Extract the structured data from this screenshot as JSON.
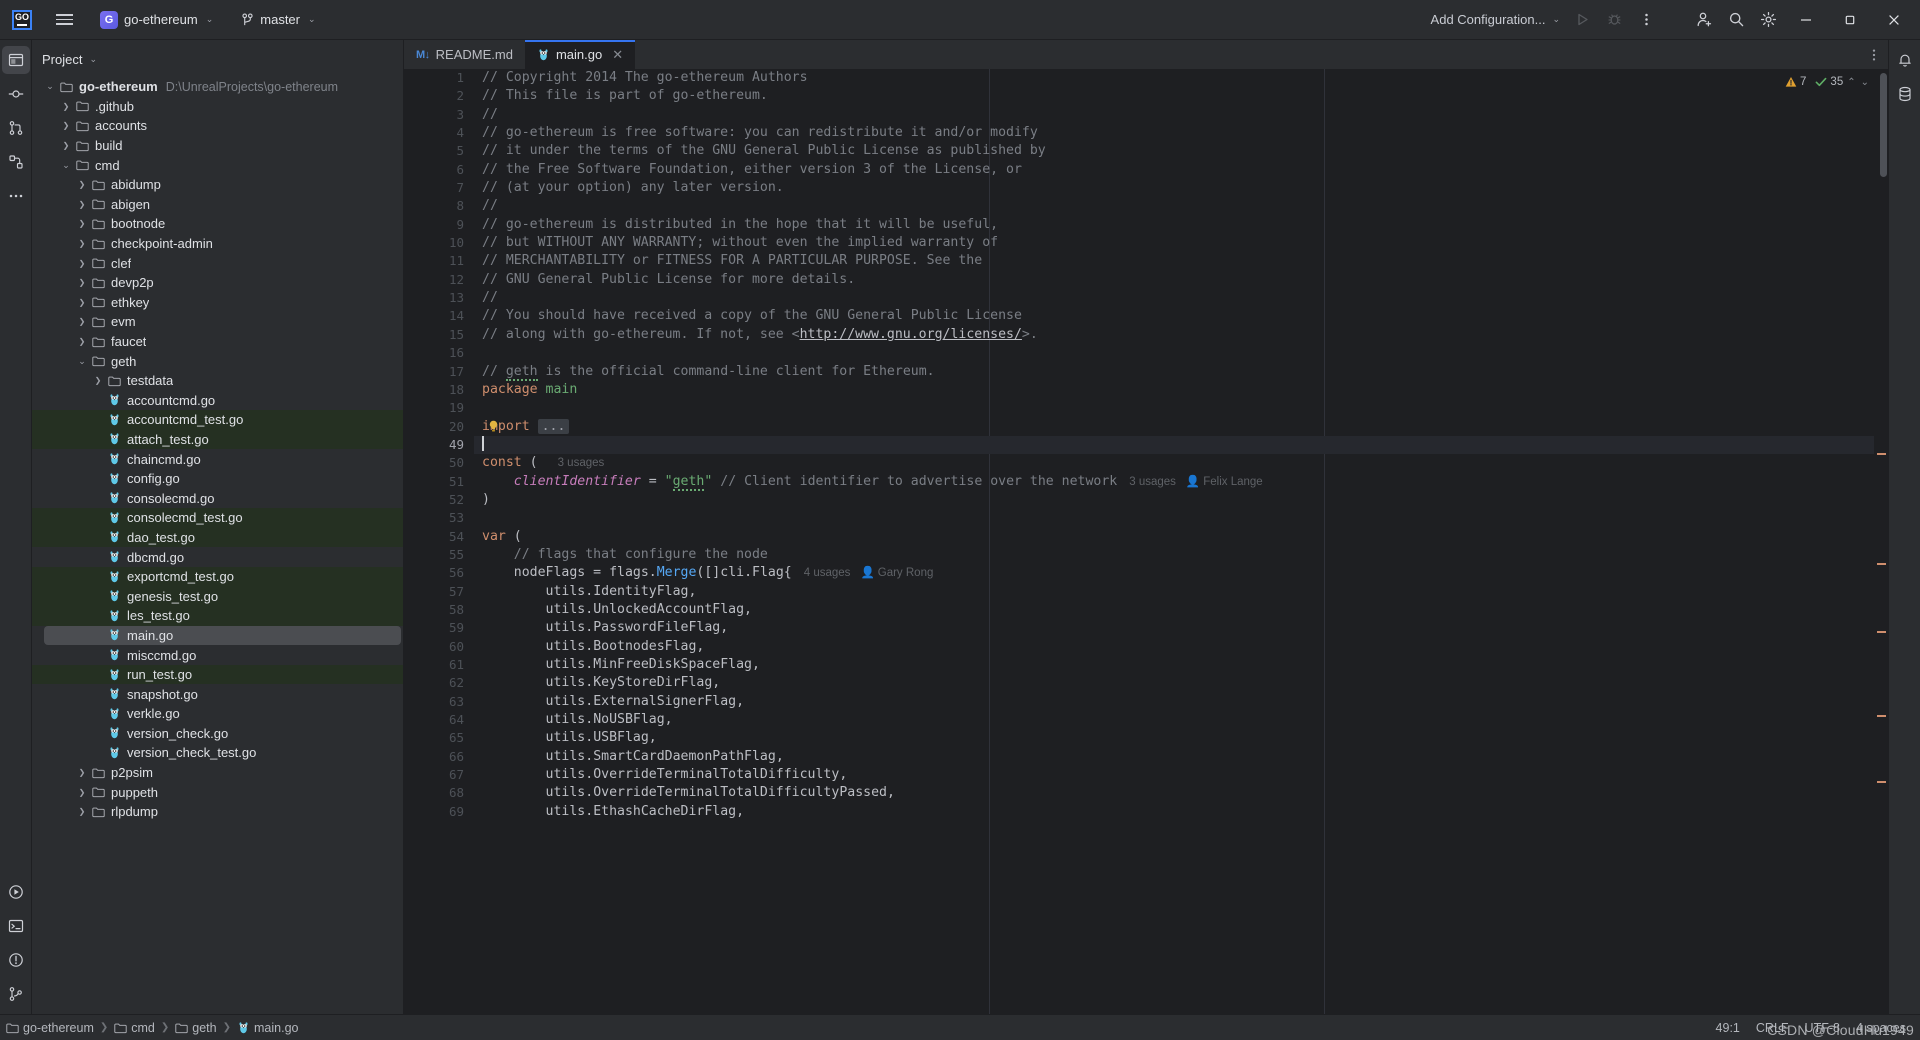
{
  "titlebar": {
    "logo_text": "GO",
    "project_badge": "G",
    "project_name": "go-ethereum",
    "branch": "master",
    "run_config": "Add Configuration...",
    "icons": {
      "hamburger": "hamburger-icon",
      "branch": "branch-icon",
      "run": "run-icon",
      "debug": "debug-icon",
      "more": "more-vertical-icon",
      "account": "add-account-icon",
      "search": "search-icon",
      "settings": "gear-icon",
      "minimize": "minimize-icon",
      "maximize": "maximize-icon",
      "close": "close-icon"
    }
  },
  "left_rail": [
    {
      "name": "project-tool-icon",
      "label": "Project",
      "active": true
    },
    {
      "name": "commit-tool-icon",
      "label": "Commit",
      "active": false
    },
    {
      "name": "pull-requests-tool-icon",
      "label": "Pull Requests",
      "active": false
    },
    {
      "name": "structure-tool-icon",
      "label": "Structure",
      "active": false
    },
    {
      "name": "more-tool-windows-icon",
      "label": "More Tool Windows",
      "active": false
    },
    {
      "name": "run-tool-icon",
      "label": "Run",
      "active": false
    },
    {
      "name": "terminal-tool-icon",
      "label": "Terminal",
      "active": false
    },
    {
      "name": "problems-tool-icon",
      "label": "Problems",
      "active": false
    },
    {
      "name": "git-tool-icon",
      "label": "Git",
      "active": false
    }
  ],
  "right_rail": [
    {
      "name": "notifications-icon",
      "label": "Notifications"
    },
    {
      "name": "database-icon",
      "label": "Database"
    }
  ],
  "project_panel": {
    "title": "Project",
    "tree": [
      {
        "indent": 0,
        "arrow": "down",
        "icon": "folder",
        "label": "go-ethereum",
        "bold": true,
        "path": "D:\\UnrealProjects\\go-ethereum"
      },
      {
        "indent": 1,
        "arrow": "right",
        "icon": "folder",
        "label": ".github"
      },
      {
        "indent": 1,
        "arrow": "right",
        "icon": "folder",
        "label": "accounts"
      },
      {
        "indent": 1,
        "arrow": "right",
        "icon": "folder",
        "label": "build"
      },
      {
        "indent": 1,
        "arrow": "down",
        "icon": "folder",
        "label": "cmd"
      },
      {
        "indent": 2,
        "arrow": "right",
        "icon": "folder",
        "label": "abidump"
      },
      {
        "indent": 2,
        "arrow": "right",
        "icon": "folder",
        "label": "abigen"
      },
      {
        "indent": 2,
        "arrow": "right",
        "icon": "folder",
        "label": "bootnode"
      },
      {
        "indent": 2,
        "arrow": "right",
        "icon": "folder",
        "label": "checkpoint-admin"
      },
      {
        "indent": 2,
        "arrow": "right",
        "icon": "folder",
        "label": "clef"
      },
      {
        "indent": 2,
        "arrow": "right",
        "icon": "folder",
        "label": "devp2p"
      },
      {
        "indent": 2,
        "arrow": "right",
        "icon": "folder",
        "label": "ethkey"
      },
      {
        "indent": 2,
        "arrow": "right",
        "icon": "folder",
        "label": "evm"
      },
      {
        "indent": 2,
        "arrow": "right",
        "icon": "folder",
        "label": "faucet"
      },
      {
        "indent": 2,
        "arrow": "down",
        "icon": "folder",
        "label": "geth"
      },
      {
        "indent": 3,
        "arrow": "right",
        "icon": "folder",
        "label": "testdata"
      },
      {
        "indent": 3,
        "arrow": "none",
        "icon": "go",
        "label": "accountcmd.go"
      },
      {
        "indent": 3,
        "arrow": "none",
        "icon": "go",
        "label": "accountcmd_test.go",
        "test": true
      },
      {
        "indent": 3,
        "arrow": "none",
        "icon": "go",
        "label": "attach_test.go",
        "test": true
      },
      {
        "indent": 3,
        "arrow": "none",
        "icon": "go",
        "label": "chaincmd.go"
      },
      {
        "indent": 3,
        "arrow": "none",
        "icon": "go",
        "label": "config.go"
      },
      {
        "indent": 3,
        "arrow": "none",
        "icon": "go",
        "label": "consolecmd.go"
      },
      {
        "indent": 3,
        "arrow": "none",
        "icon": "go",
        "label": "consolecmd_test.go",
        "test": true
      },
      {
        "indent": 3,
        "arrow": "none",
        "icon": "go",
        "label": "dao_test.go",
        "test": true
      },
      {
        "indent": 3,
        "arrow": "none",
        "icon": "go",
        "label": "dbcmd.go"
      },
      {
        "indent": 3,
        "arrow": "none",
        "icon": "go",
        "label": "exportcmd_test.go",
        "test": true
      },
      {
        "indent": 3,
        "arrow": "none",
        "icon": "go",
        "label": "genesis_test.go",
        "test": true
      },
      {
        "indent": 3,
        "arrow": "none",
        "icon": "go",
        "label": "les_test.go",
        "test": true
      },
      {
        "indent": 3,
        "arrow": "none",
        "icon": "go",
        "label": "main.go",
        "selected": true
      },
      {
        "indent": 3,
        "arrow": "none",
        "icon": "go",
        "label": "misccmd.go"
      },
      {
        "indent": 3,
        "arrow": "none",
        "icon": "go",
        "label": "run_test.go",
        "test": true
      },
      {
        "indent": 3,
        "arrow": "none",
        "icon": "go",
        "label": "snapshot.go"
      },
      {
        "indent": 3,
        "arrow": "none",
        "icon": "go",
        "label": "verkle.go"
      },
      {
        "indent": 3,
        "arrow": "none",
        "icon": "go",
        "label": "version_check.go"
      },
      {
        "indent": 3,
        "arrow": "none",
        "icon": "go",
        "label": "version_check_test.go"
      },
      {
        "indent": 2,
        "arrow": "right",
        "icon": "folder",
        "label": "p2psim"
      },
      {
        "indent": 2,
        "arrow": "right",
        "icon": "folder",
        "label": "puppeth"
      },
      {
        "indent": 2,
        "arrow": "right",
        "icon": "folder",
        "label": "rlpdump"
      }
    ]
  },
  "tabs": [
    {
      "label": "README.md",
      "icon": "markdown-icon",
      "active": false,
      "closable": false
    },
    {
      "label": "main.go",
      "icon": "go-icon",
      "active": true,
      "closable": true
    }
  ],
  "inspections": {
    "warnings": "7",
    "ok": "35"
  },
  "editor": {
    "lines": [
      {
        "n": "1",
        "tokens": [
          {
            "t": "// Copyright 2014 The go-ethereum Authors",
            "c": "c-com"
          }
        ]
      },
      {
        "n": "2",
        "tokens": [
          {
            "t": "// This file is part of go-ethereum.",
            "c": "c-com"
          }
        ]
      },
      {
        "n": "3",
        "tokens": [
          {
            "t": "//",
            "c": "c-com"
          }
        ]
      },
      {
        "n": "4",
        "tokens": [
          {
            "t": "// go-ethereum is free software: you can redistribute it and/or modify",
            "c": "c-com"
          }
        ]
      },
      {
        "n": "5",
        "tokens": [
          {
            "t": "// it under the terms of the GNU General Public License as published by",
            "c": "c-com"
          }
        ]
      },
      {
        "n": "6",
        "tokens": [
          {
            "t": "// the Free Software Foundation, either version 3 of the License, or",
            "c": "c-com"
          }
        ]
      },
      {
        "n": "7",
        "tokens": [
          {
            "t": "// (at your option) any later version.",
            "c": "c-com"
          }
        ]
      },
      {
        "n": "8",
        "tokens": [
          {
            "t": "//",
            "c": "c-com"
          }
        ]
      },
      {
        "n": "9",
        "tokens": [
          {
            "t": "// go-ethereum is distributed in the hope that it will be useful,",
            "c": "c-com"
          }
        ]
      },
      {
        "n": "10",
        "tokens": [
          {
            "t": "// but WITHOUT ANY WARRANTY; without even the implied warranty of",
            "c": "c-com"
          }
        ]
      },
      {
        "n": "11",
        "tokens": [
          {
            "t": "// MERCHANTABILITY or FITNESS FOR A PARTICULAR PURPOSE. See the",
            "c": "c-com"
          }
        ]
      },
      {
        "n": "12",
        "tokens": [
          {
            "t": "// GNU General Public License for more details.",
            "c": "c-com"
          }
        ]
      },
      {
        "n": "13",
        "tokens": [
          {
            "t": "//",
            "c": "c-com"
          }
        ]
      },
      {
        "n": "14",
        "tokens": [
          {
            "t": "// You should have received a copy of the GNU General Public License",
            "c": "c-com"
          }
        ]
      },
      {
        "n": "15",
        "tokens": [
          {
            "t": "// along with go-ethereum. If not, see <",
            "c": "c-com"
          },
          {
            "t": "http://www.gnu.org/licenses/",
            "c": "c-link"
          },
          {
            "t": ">.",
            "c": "c-com"
          }
        ]
      },
      {
        "n": "16",
        "tokens": []
      },
      {
        "n": "17",
        "tokens": [
          {
            "t": "// ",
            "c": "c-com"
          },
          {
            "t": "geth",
            "c": "c-com c-typo"
          },
          {
            "t": " is the official command-line client for Ethereum.",
            "c": "c-com"
          }
        ]
      },
      {
        "n": "18",
        "tokens": [
          {
            "t": "package",
            "c": "c-kw"
          },
          {
            "t": " ",
            "c": "c-txt"
          },
          {
            "t": "main",
            "c": "c-str"
          }
        ]
      },
      {
        "n": "19",
        "tokens": []
      },
      {
        "n": "20",
        "fold": true,
        "bulb": true,
        "tokens": [
          {
            "t": "import",
            "c": "c-kw"
          },
          {
            "t": " ",
            "c": "c-txt"
          }
        ]
      },
      {
        "n": "49",
        "caret": true,
        "tokens": []
      },
      {
        "n": "50",
        "tokens": [
          {
            "t": "const",
            "c": "c-kw"
          },
          {
            "t": " (",
            "c": "c-txt"
          }
        ],
        "hint": "3 usages"
      },
      {
        "n": "51",
        "tokens": [
          {
            "t": "    ",
            "c": "c-txt"
          },
          {
            "t": "clientIdentifier",
            "c": "c-fld"
          },
          {
            "t": " = ",
            "c": "c-txt"
          },
          {
            "t": "\"",
            "c": "c-str"
          },
          {
            "t": "geth",
            "c": "c-str c-typo"
          },
          {
            "t": "\"",
            "c": "c-str"
          },
          {
            "t": " // Client identifier to advertise over the network",
            "c": "c-com"
          }
        ],
        "hint": "3 usages",
        "author": "Felix Lange"
      },
      {
        "n": "52",
        "tokens": [
          {
            "t": ")",
            "c": "c-txt"
          }
        ]
      },
      {
        "n": "53",
        "tokens": []
      },
      {
        "n": "54",
        "tokens": [
          {
            "t": "var",
            "c": "c-kw"
          },
          {
            "t": " (",
            "c": "c-txt"
          }
        ]
      },
      {
        "n": "55",
        "tokens": [
          {
            "t": "    // flags that configure the node",
            "c": "c-com"
          }
        ]
      },
      {
        "n": "56",
        "tokens": [
          {
            "t": "    ",
            "c": "c-txt"
          },
          {
            "t": "nodeFlags",
            "c": "c-txt"
          },
          {
            "t": " = ",
            "c": "c-txt"
          },
          {
            "t": "flags",
            "c": "c-txt"
          },
          {
            "t": ".",
            "c": "c-txt"
          },
          {
            "t": "Merge",
            "c": "c-fn"
          },
          {
            "t": "([]",
            "c": "c-txt"
          },
          {
            "t": "cli",
            "c": "c-txt"
          },
          {
            "t": ".",
            "c": "c-txt"
          },
          {
            "t": "Flag",
            "c": "c-txt"
          },
          {
            "t": "{",
            "c": "c-txt"
          }
        ],
        "hint": "4 usages",
        "author": "Gary Rong"
      },
      {
        "n": "57",
        "tokens": [
          {
            "t": "        ",
            "c": "c-txt"
          },
          {
            "t": "utils",
            "c": "c-txt"
          },
          {
            "t": ".",
            "c": "c-txt"
          },
          {
            "t": "IdentityFlag",
            "c": "c-txt"
          },
          {
            "t": ",",
            "c": "c-txt"
          }
        ]
      },
      {
        "n": "58",
        "tokens": [
          {
            "t": "        ",
            "c": "c-txt"
          },
          {
            "t": "utils",
            "c": "c-txt"
          },
          {
            "t": ".",
            "c": "c-txt"
          },
          {
            "t": "UnlockedAccountFlag",
            "c": "c-txt"
          },
          {
            "t": ",",
            "c": "c-txt"
          }
        ]
      },
      {
        "n": "59",
        "tokens": [
          {
            "t": "        ",
            "c": "c-txt"
          },
          {
            "t": "utils",
            "c": "c-txt"
          },
          {
            "t": ".",
            "c": "c-txt"
          },
          {
            "t": "PasswordFileFlag",
            "c": "c-txt"
          },
          {
            "t": ",",
            "c": "c-txt"
          }
        ]
      },
      {
        "n": "60",
        "tokens": [
          {
            "t": "        ",
            "c": "c-txt"
          },
          {
            "t": "utils",
            "c": "c-txt"
          },
          {
            "t": ".",
            "c": "c-txt"
          },
          {
            "t": "BootnodesFlag",
            "c": "c-txt"
          },
          {
            "t": ",",
            "c": "c-txt"
          }
        ]
      },
      {
        "n": "61",
        "tokens": [
          {
            "t": "        ",
            "c": "c-txt"
          },
          {
            "t": "utils",
            "c": "c-txt"
          },
          {
            "t": ".",
            "c": "c-txt"
          },
          {
            "t": "MinFreeDiskSpaceFlag",
            "c": "c-txt"
          },
          {
            "t": ",",
            "c": "c-txt"
          }
        ]
      },
      {
        "n": "62",
        "tokens": [
          {
            "t": "        ",
            "c": "c-txt"
          },
          {
            "t": "utils",
            "c": "c-txt"
          },
          {
            "t": ".",
            "c": "c-txt"
          },
          {
            "t": "KeyStoreDirFlag",
            "c": "c-txt"
          },
          {
            "t": ",",
            "c": "c-txt"
          }
        ]
      },
      {
        "n": "63",
        "tokens": [
          {
            "t": "        ",
            "c": "c-txt"
          },
          {
            "t": "utils",
            "c": "c-txt"
          },
          {
            "t": ".",
            "c": "c-txt"
          },
          {
            "t": "ExternalSignerFlag",
            "c": "c-txt"
          },
          {
            "t": ",",
            "c": "c-txt"
          }
        ]
      },
      {
        "n": "64",
        "tokens": [
          {
            "t": "        ",
            "c": "c-txt"
          },
          {
            "t": "utils",
            "c": "c-txt"
          },
          {
            "t": ".",
            "c": "c-txt"
          },
          {
            "t": "NoUSBFlag",
            "c": "c-txt"
          },
          {
            "t": ",",
            "c": "c-txt"
          }
        ]
      },
      {
        "n": "65",
        "tokens": [
          {
            "t": "        ",
            "c": "c-txt"
          },
          {
            "t": "utils",
            "c": "c-txt"
          },
          {
            "t": ".",
            "c": "c-txt"
          },
          {
            "t": "USBFlag",
            "c": "c-txt"
          },
          {
            "t": ",",
            "c": "c-txt"
          }
        ]
      },
      {
        "n": "66",
        "tokens": [
          {
            "t": "        ",
            "c": "c-txt"
          },
          {
            "t": "utils",
            "c": "c-txt"
          },
          {
            "t": ".",
            "c": "c-txt"
          },
          {
            "t": "SmartCardDaemonPathFlag",
            "c": "c-txt"
          },
          {
            "t": ",",
            "c": "c-txt"
          }
        ]
      },
      {
        "n": "67",
        "tokens": [
          {
            "t": "        ",
            "c": "c-txt"
          },
          {
            "t": "utils",
            "c": "c-txt"
          },
          {
            "t": ".",
            "c": "c-txt"
          },
          {
            "t": "OverrideTerminalTotalDifficulty",
            "c": "c-txt"
          },
          {
            "t": ",",
            "c": "c-txt"
          }
        ]
      },
      {
        "n": "68",
        "tokens": [
          {
            "t": "        ",
            "c": "c-txt"
          },
          {
            "t": "utils",
            "c": "c-txt"
          },
          {
            "t": ".",
            "c": "c-txt"
          },
          {
            "t": "OverrideTerminalTotalDifficultyPassed",
            "c": "c-txt"
          },
          {
            "t": ",",
            "c": "c-txt"
          }
        ]
      },
      {
        "n": "69",
        "tokens": [
          {
            "t": "        ",
            "c": "c-txt"
          },
          {
            "t": "utils",
            "c": "c-txt"
          },
          {
            "t": ".",
            "c": "c-txt"
          },
          {
            "t": "EthashCacheDirFlag",
            "c": "c-txt"
          },
          {
            "t": ",",
            "c": "c-txt"
          }
        ]
      }
    ],
    "fold_placeholder": "...",
    "markers": [
      "#cf8e6d",
      "#cf8e6d",
      "#cf8e6d",
      "#cf8e6d",
      "#cf8e6d"
    ]
  },
  "statusbar": {
    "breadcrumbs": [
      "go-ethereum",
      "cmd",
      "geth",
      "main.go"
    ],
    "caret_position": "49:1",
    "line_separator": "CRLF",
    "encoding": "UTF-8",
    "indent": "4 spaces"
  },
  "watermark": "CSDN @CloudHu1949",
  "colors": {
    "accent": "#3574f0",
    "comment": "#7a7e85",
    "keyword": "#cf8e6d",
    "string": "#6aab73",
    "field": "#c77dbb",
    "function": "#56a8f5",
    "editor_bg": "#1e1f22",
    "panel_bg": "#2b2d30",
    "test_file_bg": "#253022",
    "warning": "#e0a030",
    "ok": "#5fad65"
  }
}
